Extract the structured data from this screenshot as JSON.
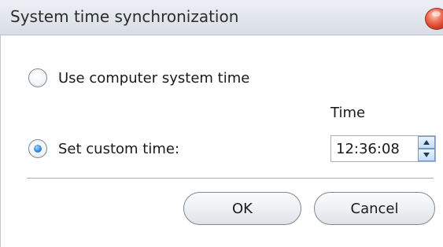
{
  "window": {
    "title": "System time synchronization"
  },
  "options": {
    "computer_time_label": "Use computer system time",
    "computer_time_selected": false,
    "custom_time_label": "Set custom time:",
    "custom_time_selected": true
  },
  "time": {
    "label": "Time",
    "value": "12:36:08"
  },
  "buttons": {
    "ok_label": "OK",
    "cancel_label": "Cancel"
  },
  "colors": {
    "accent": "#3c8ee4",
    "close_button": "#d8432b"
  },
  "icons": {
    "close": "close-icon",
    "spin_up": "chevron-up-icon",
    "spin_down": "chevron-down-icon"
  }
}
